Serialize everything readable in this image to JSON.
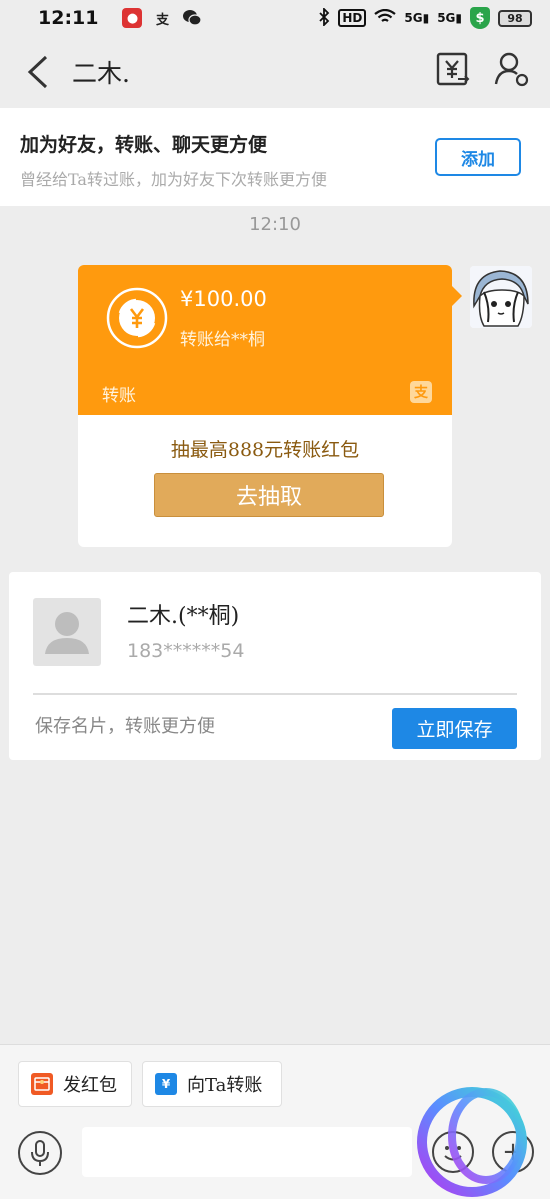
{
  "status_bar": {
    "time": "12:11",
    "app_icons": [
      "red-app-icon",
      "alipay-mini-icon",
      "wechat-icon"
    ],
    "network_labels": [
      "HD",
      "5G",
      "5G"
    ],
    "battery": "98"
  },
  "nav": {
    "title": "二木."
  },
  "add_banner": {
    "title": "加为好友，转账、聊天更方便",
    "subtitle": "曾经给Ta转过账，加为好友下次转账更方便",
    "button": "添加"
  },
  "chat": {
    "timestamp": "12:10",
    "transfer": {
      "amount": "¥100.00",
      "recipient": "转账给**桐",
      "label": "转账",
      "promo": "抽最高888元转账红包",
      "button": "去抽取"
    }
  },
  "contact_card": {
    "name": "二木.(**桐)",
    "phone": "183******54",
    "hint": "保存名片，转账更方便",
    "button": "立即保存"
  },
  "bottom": {
    "red_packet": "发红包",
    "transfer": "向Ta转账",
    "input_placeholder": ""
  },
  "colors": {
    "orange": "#ff9a0e",
    "blue": "#1e88e5",
    "gold": "#e1aa5a"
  }
}
